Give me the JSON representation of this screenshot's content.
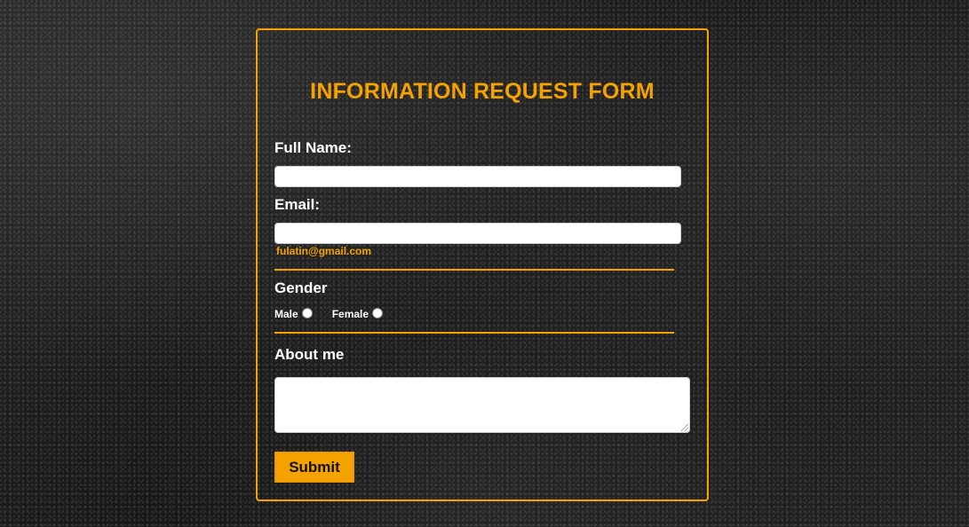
{
  "form": {
    "title": "INFORMATION REQUEST FORM",
    "accent_color": "#f5a100",
    "full_name": {
      "label": "Full Name:",
      "value": ""
    },
    "email": {
      "label": "Email:",
      "value": "",
      "hint": "fulatin@gmail.com"
    },
    "gender": {
      "label": "Gender",
      "options": [
        {
          "label": "Male",
          "checked": false
        },
        {
          "label": "Female",
          "checked": false
        }
      ]
    },
    "about": {
      "label": "About me",
      "value": ""
    },
    "submit_label": "Submit"
  }
}
